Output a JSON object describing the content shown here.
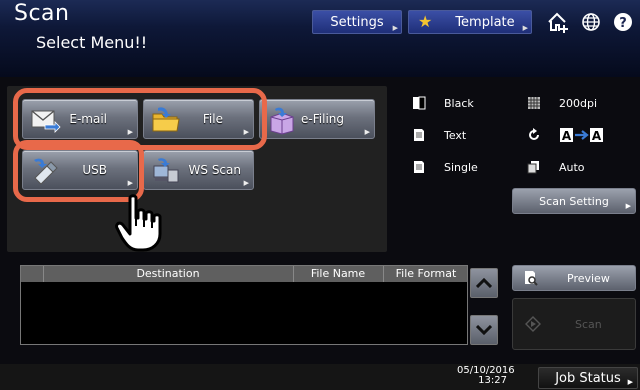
{
  "header": {
    "app_title": "Scan",
    "subtitle": "Select Menu!!",
    "settings_label": "Settings",
    "template_label": "Template"
  },
  "menu": {
    "email": "E-mail",
    "file": "File",
    "efiling": "e-Filing",
    "usb": "USB",
    "wsscan": "WS Scan"
  },
  "settings": {
    "color_mode": "Black",
    "resolution": "200dpi",
    "original_mode": "Text",
    "duplex": "Single",
    "size": "Auto",
    "scan_setting": "Scan Setting"
  },
  "table": {
    "columns": [
      "Destination",
      "File Name",
      "File Format"
    ]
  },
  "actions": {
    "preview": "Preview",
    "scan": "Scan"
  },
  "footer": {
    "date": "05/10/2016",
    "time": "13:27",
    "job_status": "Job Status"
  },
  "colors": {
    "highlight": "#e8694a",
    "topbar_button": "#2f43a0"
  }
}
